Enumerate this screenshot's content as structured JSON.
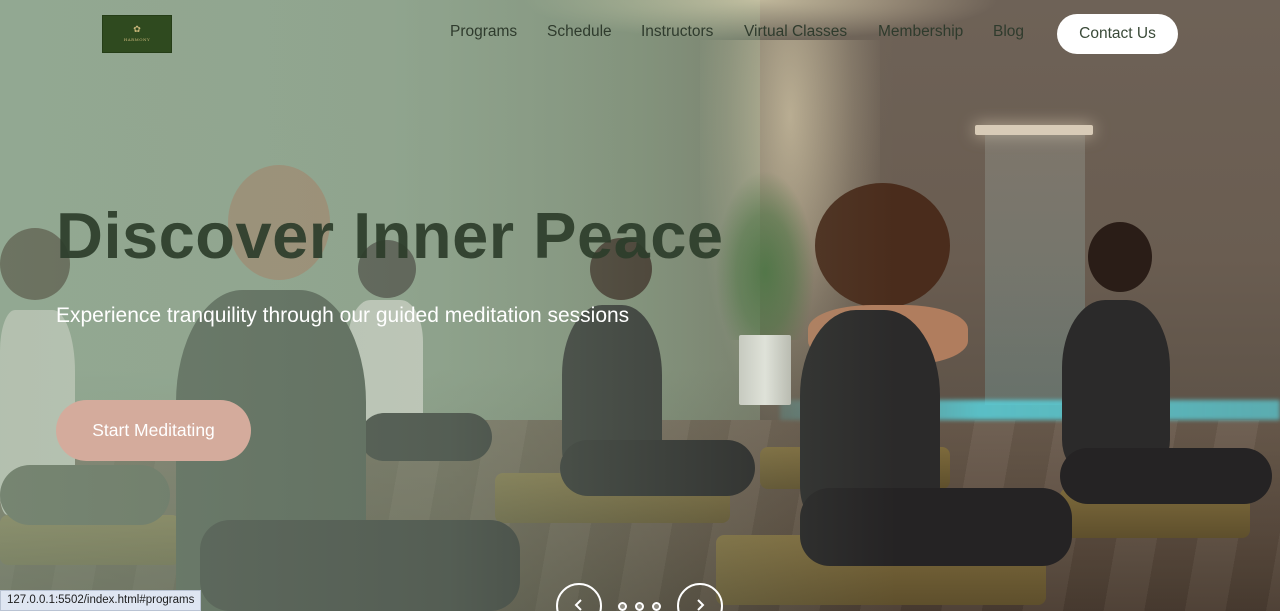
{
  "brand": {
    "logo_text": "HARMONY",
    "logo_sub": "MEDITATION"
  },
  "nav": {
    "links": [
      "Programs",
      "Schedule",
      "Instructors",
      "Virtual Classes",
      "Membership",
      "Blog"
    ],
    "contact_label": "Contact Us"
  },
  "hero": {
    "title": "Discover Inner Peace",
    "subtitle": "Experience tranquility through our guided meditation sessions",
    "cta_label": "Start Meditating",
    "slides_total": 3,
    "active_slide": 1
  },
  "slider": {
    "prev_icon": "chevron-left-icon",
    "next_icon": "chevron-right-icon"
  },
  "status_bar": {
    "url": "127.0.0.1:5502/index.html#programs"
  },
  "colors": {
    "title": "#2d3d2b",
    "cta_bg": "#d4ab9c",
    "logo_bg": "#2f4a1f",
    "nav_text": "#2f3b2d"
  }
}
